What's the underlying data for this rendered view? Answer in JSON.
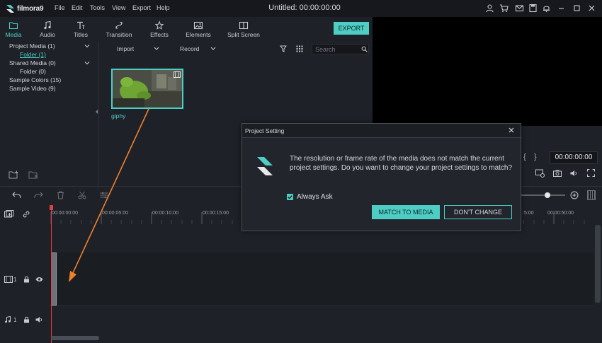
{
  "app": {
    "name": "filmora9",
    "title": "Untitled:  00:00:00:00",
    "menu": [
      "File",
      "Edit",
      "Tools",
      "View",
      "Export",
      "Help"
    ],
    "title_icons": [
      "user-icon",
      "cart-icon",
      "mail-icon",
      "save-icon",
      "notification-icon",
      "minimize-icon",
      "maximize-icon",
      "close-icon"
    ]
  },
  "toolbar": {
    "tabs": [
      {
        "label": "Media",
        "icon": "folder-icon"
      },
      {
        "label": "Audio",
        "icon": "music-note-icon"
      },
      {
        "label": "Titles",
        "icon": "text-icon"
      },
      {
        "label": "Transition",
        "icon": "transition-icon"
      },
      {
        "label": "Effects",
        "icon": "effects-icon"
      },
      {
        "label": "Elements",
        "icon": "image-icon"
      },
      {
        "label": "Split Screen",
        "icon": "split-screen-icon"
      }
    ],
    "active_tab": "Media",
    "export_label": "EXPORT"
  },
  "library": {
    "items": [
      {
        "label": "Project Media (1)"
      },
      {
        "label": "Folder (1)"
      },
      {
        "label": "Shared Media (0)"
      },
      {
        "label": "Folder (0)"
      },
      {
        "label": "Sample Colors (15)"
      },
      {
        "label": "Sample Video (9)"
      }
    ]
  },
  "media": {
    "import_label": "Import",
    "record_label": "Record",
    "search_placeholder": "Search",
    "clip_name": "giphy"
  },
  "preview": {
    "timecode": "00:00:00:00",
    "bracket_left": "{",
    "bracket_right": "}"
  },
  "timeline": {
    "ticks": [
      "00:00:00:00",
      "00:00:05:00",
      "00:00:10:00",
      "00:00:15:00",
      ":5:00",
      "00:00:50:00"
    ],
    "video_track_index": "1",
    "audio_track_index": "1"
  },
  "dialog": {
    "title": "Project Setting",
    "message": "The resolution or frame rate of the media does not match the current project settings. Do you want to change your project settings to match?",
    "checkbox_label": "Always Ask",
    "checkbox_checked": true,
    "match_label": "MATCH TO MEDIA",
    "dont_change_label": "DON'T CHANGE"
  },
  "colors": {
    "accent": "#4ecdc4",
    "background": "#1e2128",
    "playhead": "#e0413b",
    "arrow": "#f07f2a"
  }
}
